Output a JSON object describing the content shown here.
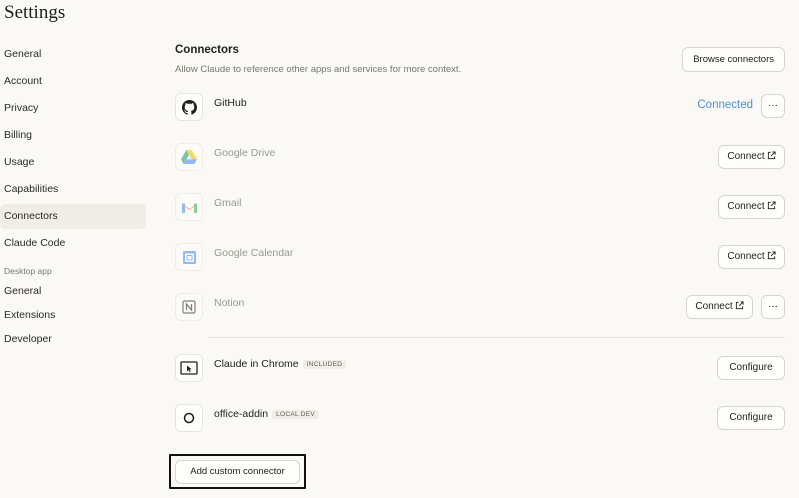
{
  "page": {
    "title": "Settings"
  },
  "sidebar": {
    "items": [
      {
        "label": "General"
      },
      {
        "label": "Account"
      },
      {
        "label": "Privacy"
      },
      {
        "label": "Billing"
      },
      {
        "label": "Usage"
      },
      {
        "label": "Capabilities"
      },
      {
        "label": "Connectors",
        "active": true
      },
      {
        "label": "Claude Code"
      }
    ],
    "desktop_section": "Desktop app",
    "desktop_items": [
      {
        "label": "General"
      },
      {
        "label": "Extensions"
      },
      {
        "label": "Developer"
      }
    ]
  },
  "connectors": {
    "title": "Connectors",
    "description": "Allow Claude to reference other apps and services for more context.",
    "browse_label": "Browse connectors",
    "status_connected": "Connected",
    "connect_label": "Connect",
    "configure_label": "Configure",
    "more_label": "···",
    "add_custom_label": "Add custom connector",
    "items": [
      {
        "name": "GitHub",
        "icon": "github-icon"
      },
      {
        "name": "Google Drive",
        "icon": "google-drive-icon"
      },
      {
        "name": "Gmail",
        "icon": "gmail-icon"
      },
      {
        "name": "Google Calendar",
        "icon": "google-calendar-icon"
      },
      {
        "name": "Notion",
        "icon": "notion-icon"
      },
      {
        "name": "Claude in Chrome",
        "tag": "INCLUDED",
        "icon": "cursor-window-icon"
      },
      {
        "name": "office-addin",
        "tag": "LOCAL DEV",
        "icon": "circle-icon"
      }
    ]
  },
  "colors": {
    "background": "#faf9f5",
    "connected": "#4f8fd8",
    "active_nav": "#efede6"
  }
}
